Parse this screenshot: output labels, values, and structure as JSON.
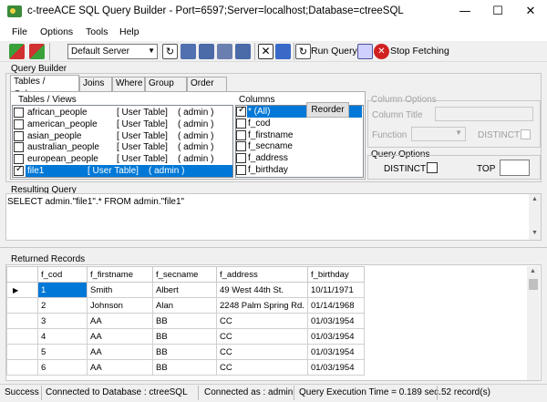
{
  "window": {
    "title": "c-treeACE SQL Query Builder - Port=6597;Server=localhost;Database=ctreeSQL",
    "minimize": "—",
    "maximize": "☐",
    "close": "✕"
  },
  "menu": [
    "File",
    "Options",
    "Tools",
    "Help"
  ],
  "toolbar": {
    "server": "Default Server",
    "run_query": "Run Query",
    "stop_fetching": "Stop Fetching"
  },
  "query_builder": {
    "label": "Query Builder",
    "tabs": [
      "Tables / Columns",
      "Joins",
      "Where",
      "Group By",
      "Order By"
    ],
    "tables_label": "Tables / Views",
    "tables": [
      {
        "name": "african_people",
        "type": "[ User Table]",
        "owner": "( admin )",
        "checked": false,
        "selected": false
      },
      {
        "name": "american_people",
        "type": "[ User Table]",
        "owner": "( admin )",
        "checked": false,
        "selected": false
      },
      {
        "name": "asian_people",
        "type": "[ User Table]",
        "owner": "( admin )",
        "checked": false,
        "selected": false
      },
      {
        "name": "australian_people",
        "type": "[ User Table]",
        "owner": "( admin )",
        "checked": false,
        "selected": false
      },
      {
        "name": "european_people",
        "type": "[ User Table]",
        "owner": "( admin )",
        "checked": false,
        "selected": false
      },
      {
        "name": "file1",
        "type": "[ User Table]",
        "owner": "( admin )",
        "checked": true,
        "selected": true
      }
    ],
    "columns_label": "Columns",
    "reorder": "Reorder",
    "columns": [
      {
        "name": "* (All)",
        "checked": true,
        "selected": true
      },
      {
        "name": "f_cod",
        "checked": false,
        "selected": false
      },
      {
        "name": "f_firstname",
        "checked": false,
        "selected": false
      },
      {
        "name": "f_secname",
        "checked": false,
        "selected": false
      },
      {
        "name": "f_address",
        "checked": false,
        "selected": false
      },
      {
        "name": "f_birthday",
        "checked": false,
        "selected": false
      }
    ],
    "column_options": {
      "label": "Column Options",
      "column_title": "Column Title",
      "function": "Function",
      "distinct": "DISTINCT"
    },
    "query_options": {
      "label": "Query Options",
      "distinct": "DISTINCT",
      "top": "TOP"
    }
  },
  "resulting_query": {
    "label": "Resulting Query",
    "sql": "SELECT admin.\"file1\".* FROM admin.\"file1\""
  },
  "records": {
    "label": "Returned Records",
    "headers": [
      "f_cod",
      "f_firstname",
      "f_secname",
      "f_address",
      "f_birthday"
    ],
    "rows": [
      [
        "1",
        "Smith",
        "Albert",
        "49 West 44th St.",
        "10/11/1971"
      ],
      [
        "2",
        "Johnson",
        "Alan",
        "2248 Palm Spring Rd.",
        "01/14/1968"
      ],
      [
        "3",
        "AA",
        "BB",
        "CC",
        "01/03/1954"
      ],
      [
        "4",
        "AA",
        "BB",
        "CC",
        "01/03/1954"
      ],
      [
        "5",
        "AA",
        "BB",
        "CC",
        "01/03/1954"
      ],
      [
        "6",
        "AA",
        "BB",
        "CC",
        "01/03/1954"
      ]
    ]
  },
  "status": {
    "state": "Success",
    "database": "Connected to Database : ctreeSQL",
    "user": "Connected as : admin",
    "exec_time": "Query Execution Time = 0.189 sec.",
    "records": "52 record(s)"
  }
}
